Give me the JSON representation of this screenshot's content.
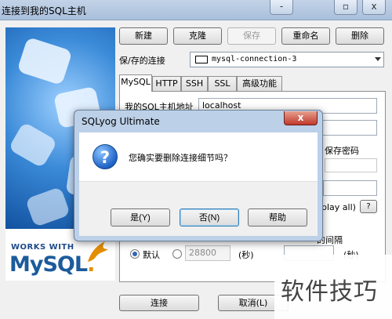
{
  "window": {
    "title": "连接到我的SQL主机",
    "minimize_symbol": "-",
    "maximize_symbol": "▫",
    "close_symbol": "x"
  },
  "toolbar": {
    "new_label": "新建",
    "clone_label": "克隆",
    "save_label": "保存",
    "rename_label": "重命名",
    "delete_label": "删除"
  },
  "connection": {
    "label": "保/存的连接",
    "selected": "mysql-connection-3"
  },
  "tabs": [
    {
      "label": "MySQL",
      "active": true
    },
    {
      "label": "HTTP",
      "active": false
    },
    {
      "label": "SSH",
      "active": false
    },
    {
      "label": "SSL",
      "active": false
    },
    {
      "label": "高级功能",
      "active": false
    }
  ],
  "mysql_tab": {
    "host_label": "我的SQL主机地址",
    "host_value": "localhost",
    "save_password_label": "保存密码",
    "play_all_text": "play all)",
    "help_small": "?",
    "interval_label": "的间隔",
    "default_label": "默认",
    "timeout_value": "28800",
    "seconds_label": "(秒)",
    "seconds_label_2": "(秒)"
  },
  "side_image": {
    "works_with": "WORKS WITH",
    "mysql_logo_text": "MySQL",
    "mysql_logo_suffix": "."
  },
  "footer": {
    "connect_label": "连接",
    "cancel_label": "取消(L)"
  },
  "dialog": {
    "title": "SQLyog Ultimate",
    "close_symbol": "x",
    "icon": "question-icon",
    "icon_glyph": "?",
    "message": "您确实要删除连接细节吗？",
    "yes_label": "是(Y)",
    "no_label": "否(N)",
    "help_label": "帮助"
  },
  "watermark": {
    "text": "软件技巧"
  },
  "colors": {
    "accent_blue": "#1c5b9b",
    "mysql_orange": "#e48e00",
    "dialog_frame": "#bcd0e8",
    "close_red": "#c0392b"
  }
}
